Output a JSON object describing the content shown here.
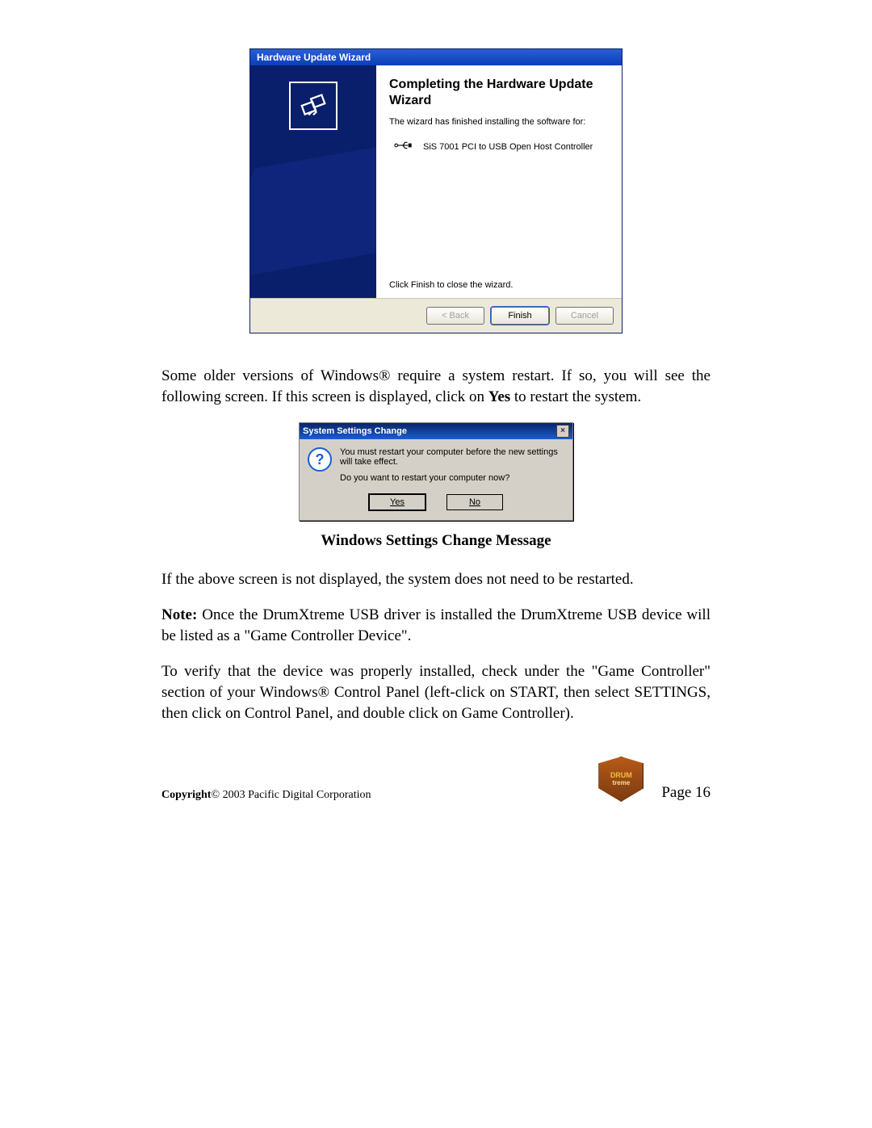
{
  "hw_wizard": {
    "title": "Hardware Update Wizard",
    "heading": "Completing the Hardware Update Wizard",
    "desc": "The wizard has finished installing the software for:",
    "device": "SiS 7001 PCI to USB Open Host Controller",
    "close_hint": "Click Finish to close the wizard.",
    "buttons": {
      "back": "< Back",
      "finish": "Finish",
      "cancel": "Cancel"
    }
  },
  "para1": "Some older versions of Windows® require a system restart.  If so, you will see the following screen.  If this screen is displayed, click on ",
  "para1_bold": "Yes",
  "para1_tail": " to restart the system.",
  "sys_dialog": {
    "title": "System Settings Change",
    "line1": "You must restart your computer before the new settings will take effect.",
    "line2": "Do you want to restart your computer now?",
    "yes": "Yes",
    "no": "No"
  },
  "caption": "Windows Settings Change Message",
  "para2": "If the above screen is not displayed, the system does not need to be restarted.",
  "note_label": "Note:",
  "note_body": " Once the DrumXtreme USB driver is installed the DrumXtreme USB device will be listed as a \"Game Controller Device\".",
  "para4": "To verify that the device was properly installed, check under the \"Game Controller\" section of your Windows® Control Panel (left-click on START, then select SETTINGS, then click on Control Panel, and double click on Game Controller).",
  "footer": {
    "copyright_label": "Copyright",
    "copyright_rest": "© 2003 Pacific Digital Corporation",
    "page": "Page 16",
    "logo_top": "DRUM",
    "logo_bot": "treme"
  }
}
